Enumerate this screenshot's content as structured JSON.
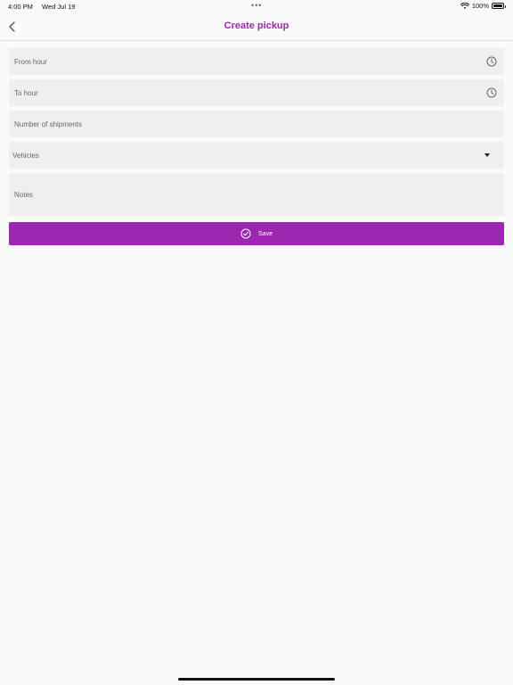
{
  "status_bar": {
    "time": "4:00 PM",
    "date": "Wed Jul 19",
    "dots": "•••",
    "battery": "100%",
    "icons": [
      "wifi-icon",
      "battery-icon"
    ]
  },
  "header": {
    "title": "Create pickup",
    "back_icon": "chevron-left-icon"
  },
  "form": {
    "from_hour": {
      "label": "From hour",
      "icon": "clock-icon"
    },
    "to_hour": {
      "label": "To hour",
      "icon": "clock-icon"
    },
    "shipments": {
      "label": "Number of shipments"
    },
    "vehicles": {
      "label": "Vehicles",
      "icon": "caret-down-icon"
    },
    "notes": {
      "label": "Notes"
    }
  },
  "save": {
    "label": "Save",
    "icon": "check-circle-icon"
  },
  "colors": {
    "accent": "#9c27b0",
    "field_bg": "#efefef",
    "background": "#fafafa"
  }
}
